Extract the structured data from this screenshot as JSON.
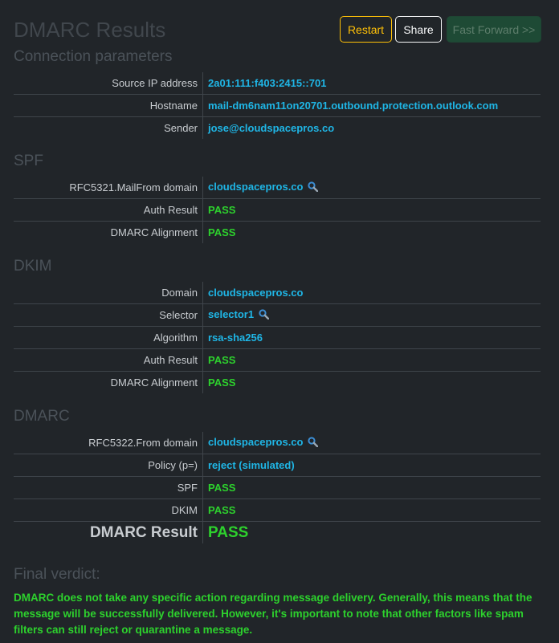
{
  "title": "DMARC Results",
  "buttons": {
    "restart": "Restart",
    "share": "Share",
    "fast_forward": "Fast Forward >>"
  },
  "connection": {
    "heading": "Connection parameters",
    "rows": [
      {
        "label": "Source IP address",
        "value": "2a01:111:f403:2415::701"
      },
      {
        "label": "Hostname",
        "value": "mail-dm6nam11on20701.outbound.protection.outlook.com"
      },
      {
        "label": "Sender",
        "value": "jose@cloudspacepros.co"
      }
    ]
  },
  "spf": {
    "heading": "SPF",
    "rows": [
      {
        "label": "RFC5321.MailFrom domain",
        "value": "cloudspacepros.co",
        "icon": "magnifier-icon"
      },
      {
        "label": "Auth Result",
        "value": "PASS"
      },
      {
        "label": "DMARC Alignment",
        "value": "PASS"
      }
    ]
  },
  "dkim": {
    "heading": "DKIM",
    "rows": [
      {
        "label": "Domain",
        "value": "cloudspacepros.co"
      },
      {
        "label": "Selector",
        "value": "selector1",
        "icon": "magnifier-icon"
      },
      {
        "label": "Algorithm",
        "value": "rsa-sha256"
      },
      {
        "label": "Auth Result",
        "value": "PASS"
      },
      {
        "label": "DMARC Alignment",
        "value": "PASS"
      }
    ]
  },
  "dmarc": {
    "heading": "DMARC",
    "rows": [
      {
        "label": "RFC5322.From domain",
        "value": "cloudspacepros.co",
        "icon": "magnifier-icon"
      },
      {
        "label": "Policy (p=)",
        "value": "reject (simulated)"
      },
      {
        "label": "SPF",
        "value": "PASS"
      },
      {
        "label": "DKIM",
        "value": "PASS"
      }
    ],
    "result_label": "DMARC Result",
    "result_value": "PASS"
  },
  "verdict": {
    "heading": "Final verdict:",
    "text": "DMARC does not take any specific action regarding message delivery. Generally, this means that the message will be successfully delivered. However, it's important to note that other factors like spam filters can still reject or quarantine a message."
  },
  "colors": {
    "background": "#212529",
    "link_blue": "#1fb6e6",
    "pass_green": "#2dd12d",
    "warning": "#ffc107"
  }
}
